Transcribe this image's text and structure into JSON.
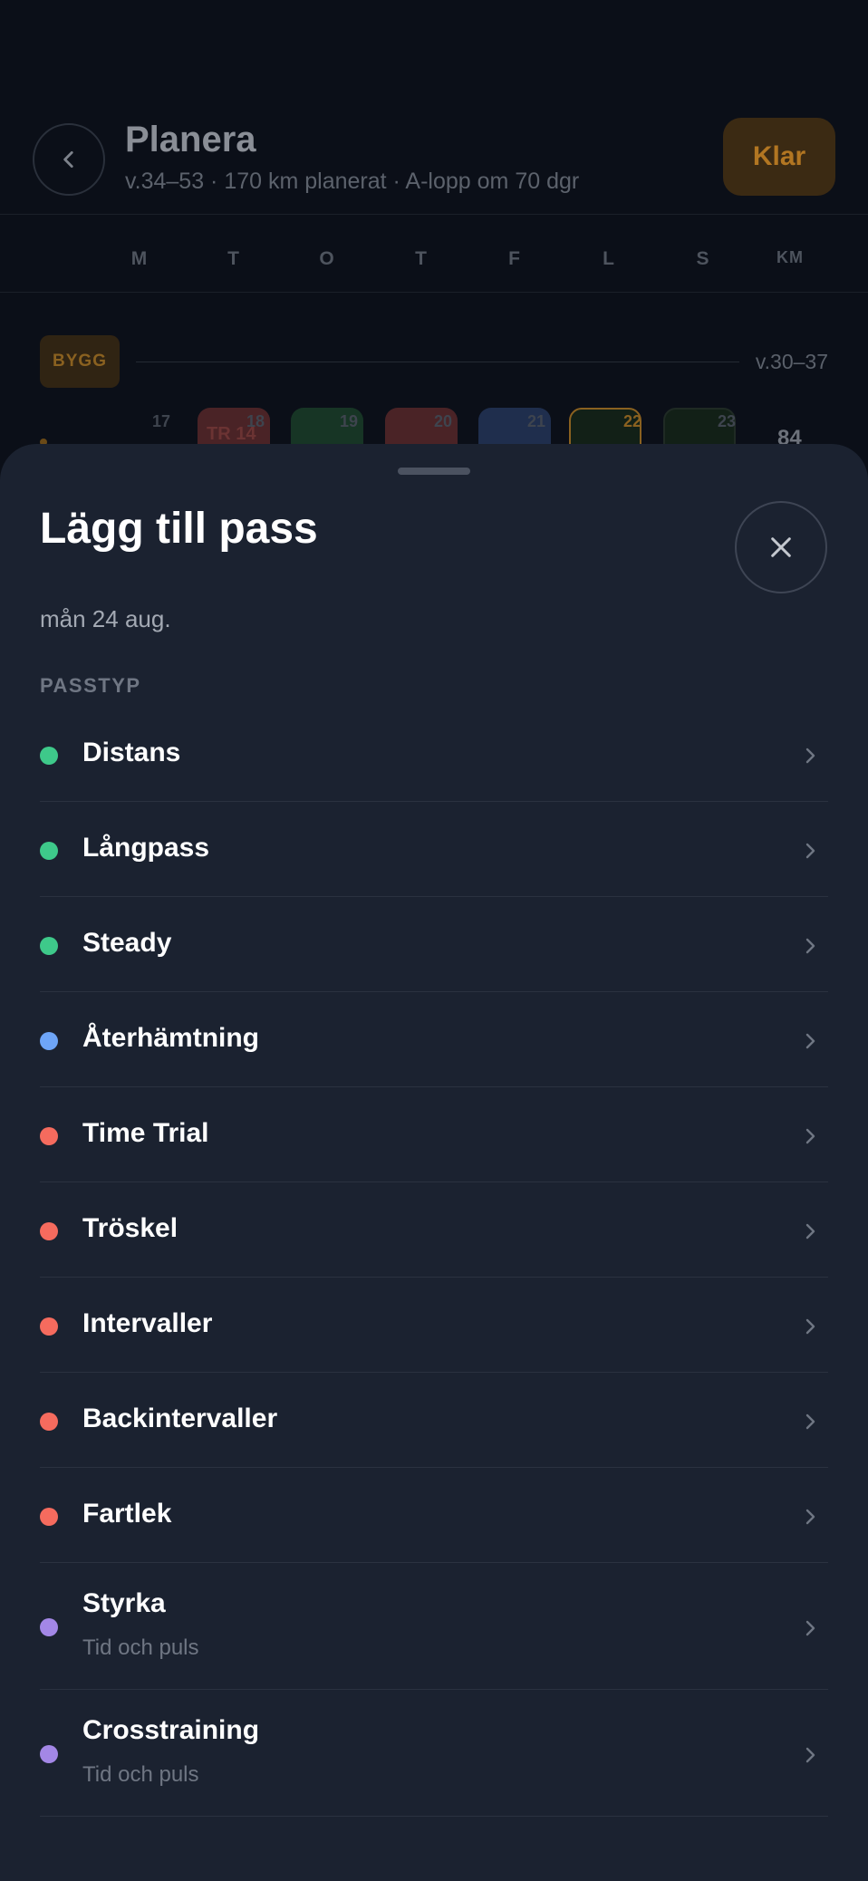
{
  "header": {
    "title": "Planera",
    "subtitle": "v.34–53 · 170 km planerat · A-lopp om 70 dgr",
    "done_label": "Klar"
  },
  "weekdays": [
    "M",
    "T",
    "O",
    "T",
    "F",
    "L",
    "S",
    "KM"
  ],
  "block": {
    "badge": "BYGG",
    "range": "v.30–37"
  },
  "week_row": {
    "days": [
      "17",
      "18",
      "19",
      "20",
      "21",
      "22",
      "23"
    ],
    "highlight_day": "22",
    "tile_label": "TR 14",
    "km": "84",
    "tile_colors": [
      "#4a2326",
      "#173525",
      "#4a2326",
      "#1f2e4d",
      "#122017",
      "#122017"
    ]
  },
  "sheet": {
    "title": "Lägg till pass",
    "date": "mån 24 aug.",
    "section_label": "PASSTYP",
    "types": [
      {
        "name": "Distans",
        "color": "#3ec98a",
        "sub": ""
      },
      {
        "name": "Långpass",
        "color": "#3ec98a",
        "sub": ""
      },
      {
        "name": "Steady",
        "color": "#3ec98a",
        "sub": ""
      },
      {
        "name": "Återhämtning",
        "color": "#6ea5f7",
        "sub": ""
      },
      {
        "name": "Time Trial",
        "color": "#f56b5e",
        "sub": ""
      },
      {
        "name": "Tröskel",
        "color": "#f56b5e",
        "sub": ""
      },
      {
        "name": "Intervaller",
        "color": "#f56b5e",
        "sub": ""
      },
      {
        "name": "Backintervaller",
        "color": "#f56b5e",
        "sub": ""
      },
      {
        "name": "Fartlek",
        "color": "#f56b5e",
        "sub": ""
      },
      {
        "name": "Styrka",
        "color": "#a387e6",
        "sub": "Tid och puls"
      },
      {
        "name": "Crosstraining",
        "color": "#a387e6",
        "sub": "Tid och puls"
      }
    ]
  }
}
